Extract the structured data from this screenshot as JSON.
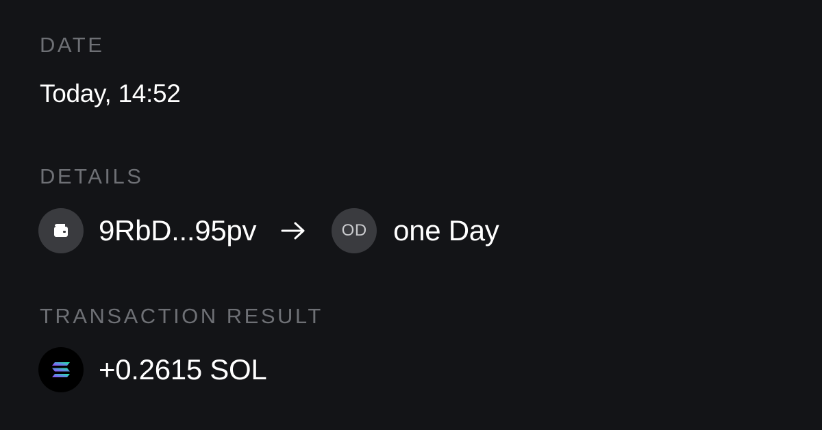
{
  "date": {
    "label": "DATE",
    "value": "Today, 14:52"
  },
  "details": {
    "label": "DETAILS",
    "from": {
      "icon": "wallet-icon",
      "address": "9RbD...95pv"
    },
    "arrow_icon": "arrow-right-icon",
    "to": {
      "avatar_initials": "OD",
      "name": "one Day"
    }
  },
  "result": {
    "label": "TRANSACTION RESULT",
    "icon": "solana-icon",
    "amount": "+0.2615 SOL"
  },
  "colors": {
    "background": "#131417",
    "label": "#6e7075",
    "text": "#ffffff",
    "avatar_bg": "#3a3b3f"
  }
}
